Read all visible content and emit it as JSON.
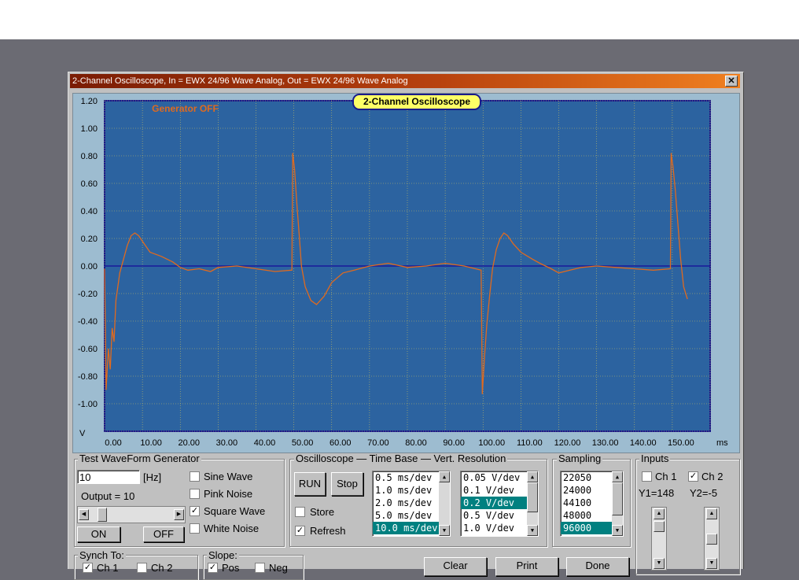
{
  "window": {
    "title": "2-Channel Oscilloscope, In = EWX 24/96 Wave Analog, Out = EWX 24/96 Wave Analog",
    "close_glyph": "✕"
  },
  "scope": {
    "badge": "2-Channel Oscilloscope",
    "generator_status": "Generator OFF",
    "y_unit": "V",
    "x_unit": "ms",
    "trace_color": "#e06a1e",
    "plot_bg": "#2c63a0",
    "grid_color": "#c8c060",
    "zero_line_color": "#1a1a9a"
  },
  "chart_data": {
    "type": "line",
    "title": "2-Channel Oscilloscope",
    "xlabel": "ms",
    "ylabel": "V",
    "xlim": [
      0,
      160
    ],
    "ylim": [
      -1.2,
      1.2
    ],
    "grid": true,
    "x_ticks": [
      "0.00",
      "10.00",
      "20.00",
      "30.00",
      "40.00",
      "50.00",
      "60.00",
      "70.00",
      "80.00",
      "90.00",
      "100.00",
      "110.00",
      "120.00",
      "130.00",
      "140.00",
      "150.00"
    ],
    "y_ticks": [
      "1.20",
      "1.00",
      "0.80",
      "0.60",
      "0.40",
      "0.20",
      "0.00",
      "-0.20",
      "-0.40",
      "-0.60",
      "-0.80",
      "-1.00"
    ],
    "series": [
      {
        "name": "Ch 2",
        "points": [
          [
            0,
            -0.02
          ],
          [
            0.4,
            -0.9
          ],
          [
            1.0,
            -0.6
          ],
          [
            1.5,
            -0.75
          ],
          [
            2.0,
            -0.45
          ],
          [
            2.5,
            -0.55
          ],
          [
            3.0,
            -0.25
          ],
          [
            4.0,
            -0.05
          ],
          [
            5.0,
            0.05
          ],
          [
            6.0,
            0.15
          ],
          [
            7.0,
            0.22
          ],
          [
            8.0,
            0.24
          ],
          [
            9.0,
            0.22
          ],
          [
            10.0,
            0.18
          ],
          [
            12.0,
            0.1
          ],
          [
            15.0,
            0.07
          ],
          [
            18.0,
            0.03
          ],
          [
            20.0,
            -0.01
          ],
          [
            22.0,
            -0.03
          ],
          [
            25.0,
            -0.02
          ],
          [
            28.0,
            -0.04
          ],
          [
            30.0,
            -0.01
          ],
          [
            35.0,
            0.0
          ],
          [
            40.0,
            -0.02
          ],
          [
            45.0,
            -0.04
          ],
          [
            49.5,
            -0.03
          ],
          [
            49.7,
            0.82
          ],
          [
            50.2,
            0.7
          ],
          [
            50.8,
            0.45
          ],
          [
            51.5,
            0.2
          ],
          [
            52.0,
            0.0
          ],
          [
            53.0,
            -0.15
          ],
          [
            54.5,
            -0.25
          ],
          [
            56.0,
            -0.28
          ],
          [
            58.0,
            -0.22
          ],
          [
            60.0,
            -0.12
          ],
          [
            63.0,
            -0.05
          ],
          [
            66.0,
            -0.03
          ],
          [
            70.0,
            0.0
          ],
          [
            75.0,
            0.02
          ],
          [
            80.0,
            -0.01
          ],
          [
            85.0,
            0.0
          ],
          [
            90.0,
            0.02
          ],
          [
            95.0,
            0.0
          ],
          [
            99.5,
            -0.03
          ],
          [
            99.8,
            -0.93
          ],
          [
            100.4,
            -0.65
          ],
          [
            101.0,
            -0.42
          ],
          [
            101.8,
            -0.2
          ],
          [
            102.5,
            -0.02
          ],
          [
            103.5,
            0.12
          ],
          [
            104.5,
            0.2
          ],
          [
            105.5,
            0.24
          ],
          [
            106.5,
            0.22
          ],
          [
            108.0,
            0.16
          ],
          [
            110.0,
            0.1
          ],
          [
            113.0,
            0.05
          ],
          [
            115.0,
            0.02
          ],
          [
            118.0,
            -0.02
          ],
          [
            120.0,
            -0.05
          ],
          [
            123.0,
            -0.03
          ],
          [
            126.0,
            -0.01
          ],
          [
            130.0,
            0.0
          ],
          [
            135.0,
            -0.01
          ],
          [
            140.0,
            -0.02
          ],
          [
            145.0,
            -0.03
          ],
          [
            149.5,
            -0.02
          ],
          [
            149.7,
            0.82
          ],
          [
            150.2,
            0.72
          ],
          [
            150.8,
            0.55
          ],
          [
            151.5,
            0.3
          ],
          [
            152.2,
            0.05
          ],
          [
            153.0,
            -0.15
          ],
          [
            154.0,
            -0.24
          ]
        ]
      }
    ]
  },
  "generator": {
    "group_label": "Test WaveForm Generator",
    "freq_value": "10",
    "freq_unit": "[Hz]",
    "output_label": "Output = 10",
    "on_label": "ON",
    "off_label": "OFF",
    "options": [
      {
        "label": "Sine Wave",
        "checked": false
      },
      {
        "label": "Pink Noise",
        "checked": false
      },
      {
        "label": "Square Wave",
        "checked": true
      },
      {
        "label": "White Noise",
        "checked": false
      }
    ]
  },
  "oscilloscope": {
    "group_label": "Oscilloscope — Time Base — Vert. Resolution",
    "run_label": "RUN",
    "stop_label": "Stop",
    "store_label": "Store",
    "store_checked": false,
    "refresh_label": "Refresh",
    "refresh_checked": true,
    "timebase_items": [
      "0.5 ms/dev",
      "1.0 ms/dev",
      "2.0 ms/dev",
      "5.0 ms/dev",
      "10.0 ms/dev"
    ],
    "timebase_selected": 4,
    "vert_items": [
      "0.05 V/dev",
      "0.1 V/dev",
      "0.2 V/dev",
      "0.5 V/dev",
      "1.0 V/dev"
    ],
    "vert_selected": 2
  },
  "sampling": {
    "group_label": "Sampling",
    "items": [
      "22050",
      "24000",
      "44100",
      "48000",
      "96000"
    ],
    "selected": 4
  },
  "inputs": {
    "group_label": "Inputs",
    "ch1_label": "Ch 1",
    "ch1_checked": false,
    "ch2_label": "Ch 2",
    "ch2_checked": true,
    "y1_label": "Y1=148",
    "y2_label": "Y2=-5"
  },
  "synch": {
    "group_label": "Synch To:",
    "ch1_label": "Ch 1",
    "ch1_checked": true,
    "ch2_label": "Ch 2",
    "ch2_checked": false
  },
  "slope": {
    "group_label": "Slope:",
    "pos_label": "Pos",
    "pos_checked": true,
    "neg_label": "Neg",
    "neg_checked": false
  },
  "buttons": {
    "clear": "Clear",
    "print": "Print",
    "done": "Done"
  }
}
